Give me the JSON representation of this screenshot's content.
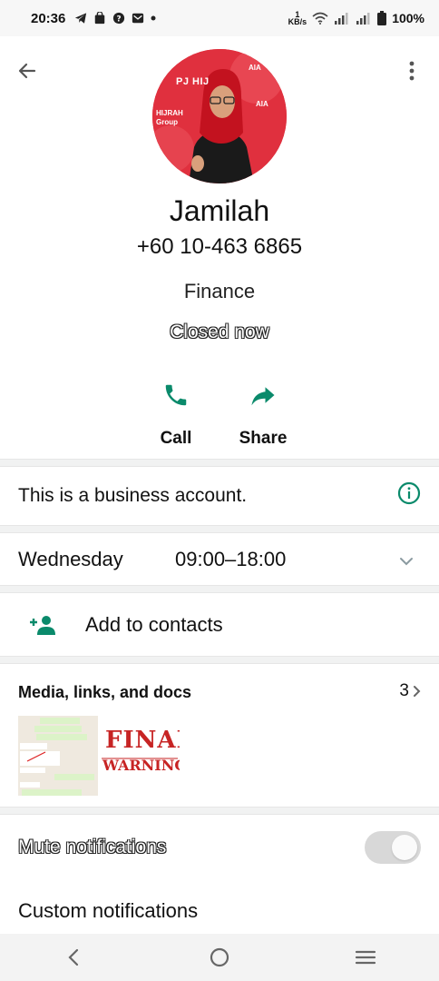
{
  "status_bar": {
    "time": "20:36",
    "network_speed_value": "1",
    "network_speed_unit": "KB/s",
    "battery": "100%"
  },
  "header": {
    "back_icon": "arrow-left-icon",
    "menu_icon": "more-vertical-icon"
  },
  "profile": {
    "name": "Jamilah",
    "phone": "+60 10-463 6865",
    "category": "Finance",
    "status": "Closed now",
    "avatar_text_1": "PJ HIJ",
    "avatar_text_2": "HIJRAH",
    "avatar_text_3": "Group",
    "avatar_text_4": "AIA",
    "avatar_text_5": "AIA"
  },
  "actions": [
    {
      "label": "Call",
      "icon": "phone-icon"
    },
    {
      "label": "Share",
      "icon": "share-arrow-icon"
    }
  ],
  "business_notice": {
    "text": "This is a business account.",
    "icon": "info-icon"
  },
  "hours": {
    "day": "Wednesday",
    "time": "09:00–18:00"
  },
  "add_contacts": {
    "label": "Add to contacts",
    "icon": "add-person-icon"
  },
  "media": {
    "title": "Media, links, and docs",
    "count": "3",
    "final_warning_line1": "FINAL",
    "final_warning_line2": "WARNING"
  },
  "mute": {
    "label": "Mute notifications",
    "enabled": false
  },
  "custom_notifications": {
    "label": "Custom notifications"
  },
  "colors": {
    "accent": "#008069",
    "divider": "#f1f2f2",
    "avatar_bg": "#d9232f"
  }
}
